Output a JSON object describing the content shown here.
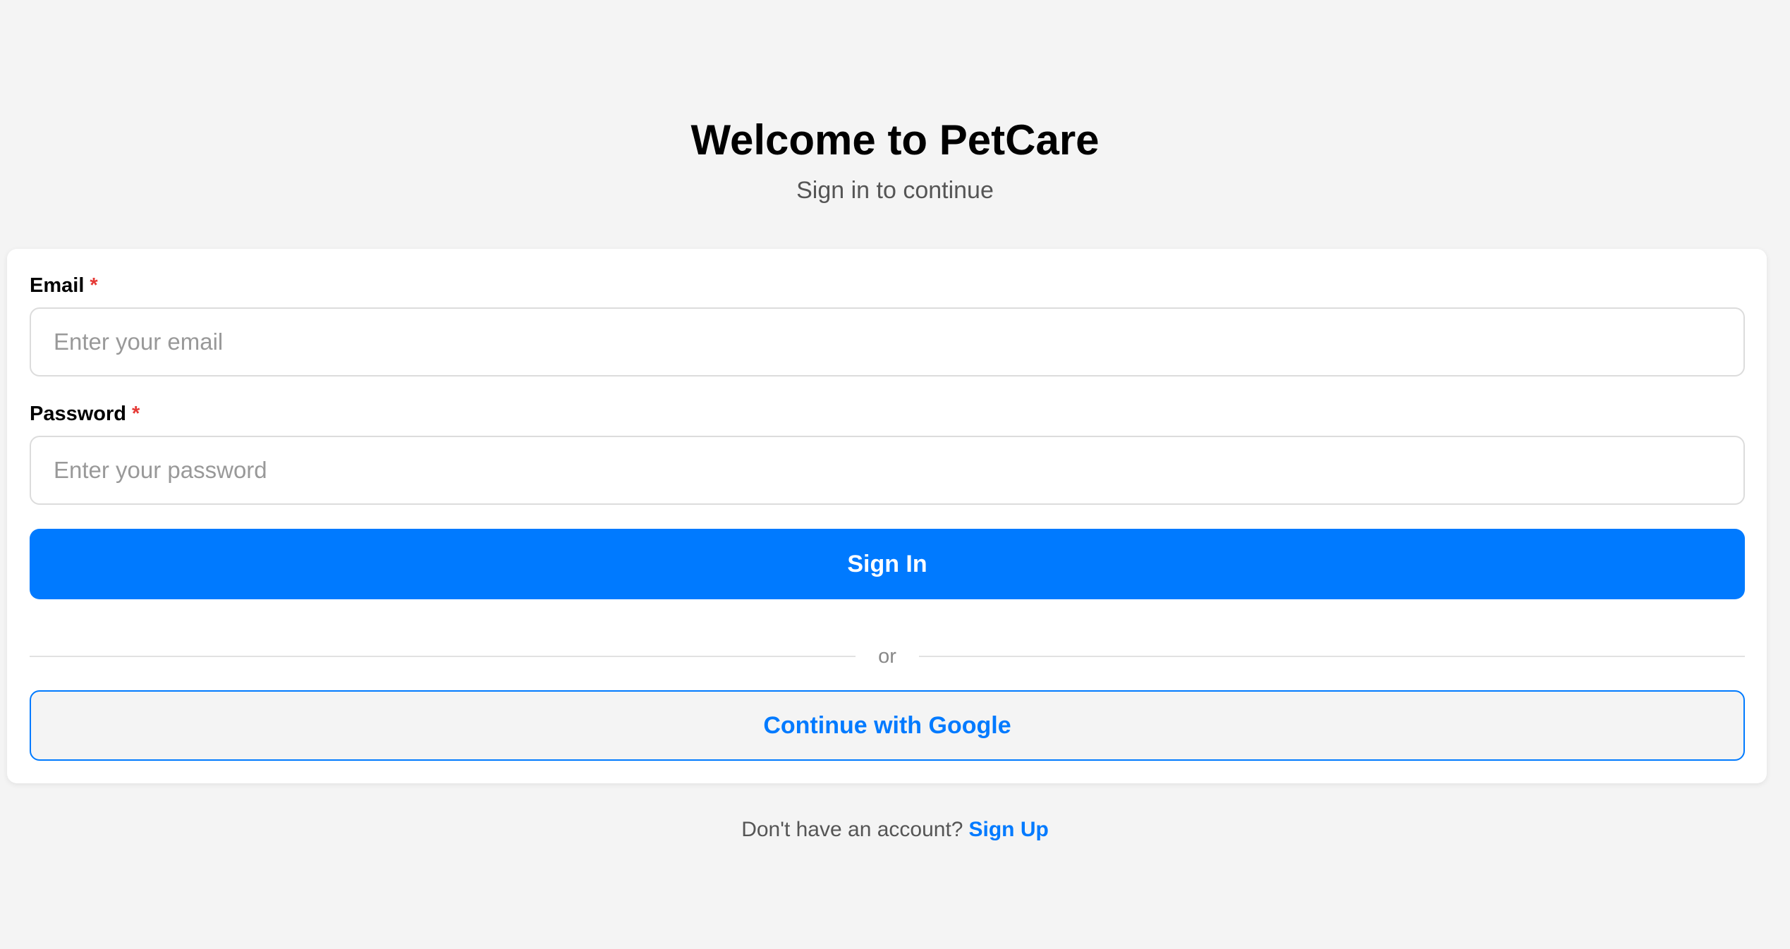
{
  "header": {
    "title": "Welcome to PetCare",
    "subtitle": "Sign in to continue"
  },
  "form": {
    "email": {
      "label": "Email",
      "required_mark": "*",
      "placeholder": "Enter your email",
      "value": ""
    },
    "password": {
      "label": "Password",
      "required_mark": "*",
      "placeholder": "Enter your password",
      "value": ""
    },
    "sign_in_label": "Sign In",
    "divider_text": "or",
    "google_label": "Continue with Google"
  },
  "footer": {
    "prompt": "Don't have an account?",
    "sign_up_label": "Sign Up"
  },
  "colors": {
    "accent": "#007aff",
    "required": "#e53935",
    "background": "#f4f4f4"
  }
}
